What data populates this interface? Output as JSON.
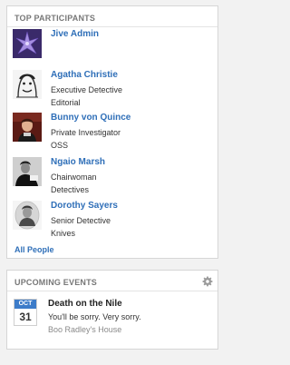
{
  "top_participants": {
    "title": "TOP PARTICIPANTS",
    "people": [
      {
        "name": "Jive Admin",
        "title": "",
        "department": ""
      },
      {
        "name": "Agatha Christie",
        "title": "Executive Detective",
        "department": "Editorial"
      },
      {
        "name": "Bunny von Quince",
        "title": "Private Investigator",
        "department": "OSS"
      },
      {
        "name": "Ngaio Marsh",
        "title": "Chairwoman",
        "department": "Detectives"
      },
      {
        "name": "Dorothy Sayers",
        "title": "Senior Detective",
        "department": "Knives"
      }
    ],
    "all_people_link": "All People"
  },
  "upcoming_events": {
    "title": "UPCOMING EVENTS",
    "settings_icon": "gear-icon",
    "events": [
      {
        "month": "OCT",
        "day": "31",
        "title": "Death on the Nile",
        "description": "You'll be sorry. Very sorry.",
        "location": "Boo Radley's House"
      }
    ]
  },
  "colors": {
    "link": "#2f6fb8",
    "calendar_header": "#3d7cc9",
    "background": "#f2f2f2"
  }
}
